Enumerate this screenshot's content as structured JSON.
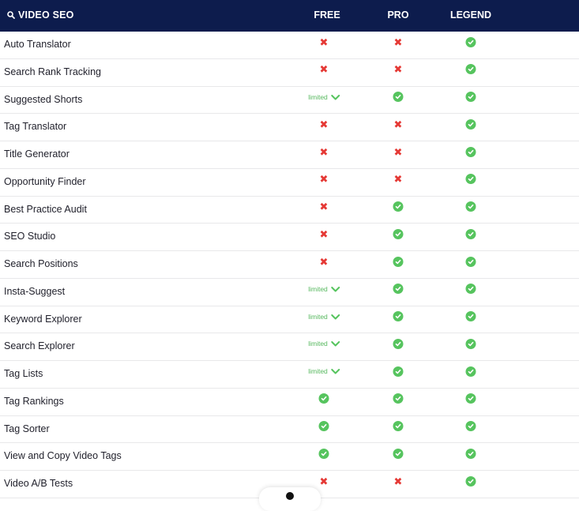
{
  "header": {
    "title": "VIDEO SEO",
    "title_icon": "search-icon",
    "columns": [
      "FREE",
      "PRO",
      "LEGEND"
    ],
    "background": "#0d1c4d"
  },
  "legend": {
    "included_icon": "check-circle-icon",
    "excluded_icon": "x-icon",
    "limited_text": "limited",
    "included_color": "#56c45e",
    "excluded_color": "#e53935"
  },
  "rows": [
    {
      "feature": "Auto Translator",
      "free": "no",
      "pro": "no",
      "legend": "yes"
    },
    {
      "feature": "Search Rank Tracking",
      "free": "no",
      "pro": "no",
      "legend": "yes"
    },
    {
      "feature": "Suggested Shorts",
      "free": "limited",
      "pro": "yes",
      "legend": "yes"
    },
    {
      "feature": "Tag Translator",
      "free": "no",
      "pro": "no",
      "legend": "yes"
    },
    {
      "feature": "Title Generator",
      "free": "no",
      "pro": "no",
      "legend": "yes"
    },
    {
      "feature": "Opportunity Finder",
      "free": "no",
      "pro": "no",
      "legend": "yes"
    },
    {
      "feature": "Best Practice Audit",
      "free": "no",
      "pro": "yes",
      "legend": "yes"
    },
    {
      "feature": "SEO Studio",
      "free": "no",
      "pro": "yes",
      "legend": "yes"
    },
    {
      "feature": "Search Positions",
      "free": "no",
      "pro": "yes",
      "legend": "yes"
    },
    {
      "feature": "Insta-Suggest",
      "free": "limited",
      "pro": "yes",
      "legend": "yes"
    },
    {
      "feature": "Keyword Explorer",
      "free": "limited",
      "pro": "yes",
      "legend": "yes"
    },
    {
      "feature": "Search Explorer",
      "free": "limited",
      "pro": "yes",
      "legend": "yes"
    },
    {
      "feature": "Tag Lists",
      "free": "limited",
      "pro": "yes",
      "legend": "yes"
    },
    {
      "feature": "Tag Rankings",
      "free": "yes",
      "pro": "yes",
      "legend": "yes"
    },
    {
      "feature": "Tag Sorter",
      "free": "yes",
      "pro": "yes",
      "legend": "yes"
    },
    {
      "feature": "View and Copy Video Tags",
      "free": "yes",
      "pro": "yes",
      "legend": "yes"
    },
    {
      "feature": "Video A/B Tests",
      "free": "no",
      "pro": "no",
      "legend": "yes"
    }
  ]
}
